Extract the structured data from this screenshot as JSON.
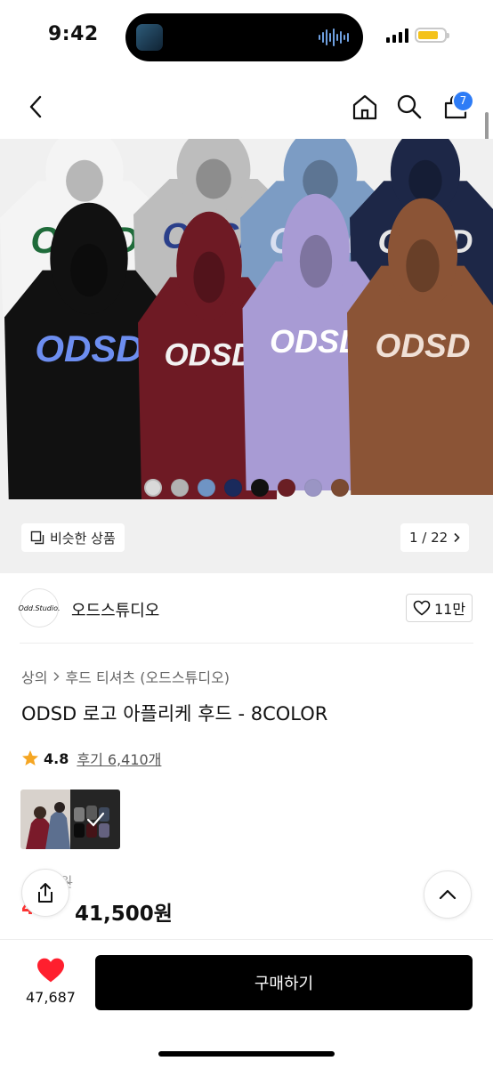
{
  "status": {
    "time": "9:42"
  },
  "header": {
    "cart_count": "7"
  },
  "hero": {
    "hoodie_print": "ODSD",
    "hoodie_colors": [
      "#f4f4f4",
      "#bdbdbd",
      "#7c9cc4",
      "#1d2747",
      "#111111",
      "#6e1a24",
      "#a89bd4",
      "#8b5436"
    ],
    "swatches": [
      "#d9d9d9",
      "#b2b2b2",
      "#6f94c4",
      "#1a2a5c",
      "#111111",
      "#6a1e24",
      "#9a95c4",
      "#7b4a32"
    ],
    "similar_label": "비슷한 상품",
    "pagination": "1 / 22"
  },
  "brand": {
    "logo_text": "Odd.Studio.",
    "name": "오드스튜디오",
    "likes": "11만"
  },
  "product": {
    "breadcrumb_category": "상의",
    "breadcrumb_sub": "후드 티셔츠 (오드스튜디오)",
    "title": "ODSD 로고 아플리케 후드 - 8COLOR",
    "rating": "4.8",
    "reviews": "후기 6,410개",
    "original_price_partial": "9원",
    "discount_partial": "4",
    "price": "41,500원"
  },
  "bottom": {
    "wish_count": "47,687",
    "buy_label": "구매하기"
  },
  "colors": {
    "accent": "#2e7cf6",
    "star": "#f5a623",
    "heart": "#ff1f2e",
    "discount": "#ff3333"
  }
}
